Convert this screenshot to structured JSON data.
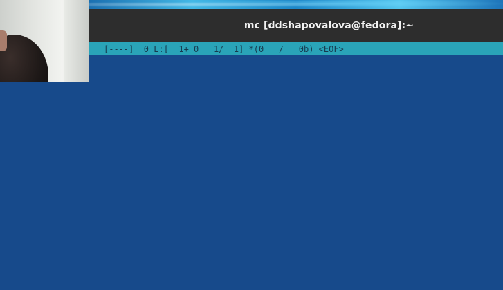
{
  "window": {
    "title": "mc [ddshapovalova@fedora]:~"
  },
  "editor": {
    "status_line": "[----]  0 L:[  1+ 0   1/  1] *(0   /   0b) <EOF>"
  },
  "webcam": {
    "icon": "camera-feed"
  },
  "colors": {
    "editor_bg": "#174a8b",
    "status_bg": "#2aa4b8",
    "titlebar_bg": "#2d2d2d"
  }
}
